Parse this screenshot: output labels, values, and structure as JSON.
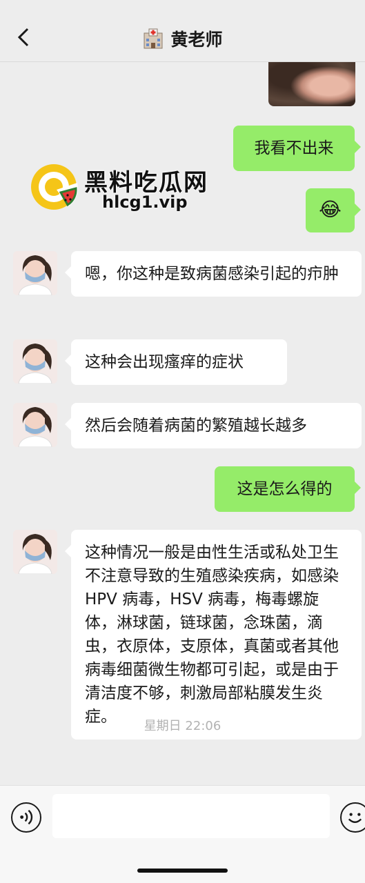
{
  "header": {
    "title": "黄老师",
    "title_icon": "hospital-icon",
    "back_icon": "chevron-left-icon"
  },
  "watermark": {
    "brand": "黑料吃瓜网",
    "url": "hlcg1.vip"
  },
  "messages": [
    {
      "side": "right",
      "type": "text",
      "text": "我看不出来"
    },
    {
      "side": "right",
      "type": "emoji",
      "text": "😂"
    },
    {
      "side": "left",
      "type": "text",
      "text": "嗯，你这种是致病菌感染引起的疖肿"
    },
    {
      "side": "left",
      "type": "text",
      "text": "这种会出现瘙痒的症状"
    },
    {
      "side": "left",
      "type": "text",
      "text": "然后会随着病菌的繁殖越长越多"
    },
    {
      "side": "right",
      "type": "text",
      "text": "这是怎么得的"
    },
    {
      "side": "left",
      "type": "text",
      "text": "这种情况一般是由性生活或私处卫生不注意导致的生殖感染疾病，如感染 HPV 病毒，HSV 病毒，梅毒螺旋体，淋球菌，链球菌，念珠菌，滴虫，衣原体，支原体，真菌或者其他病毒细菌微生物都可引起，或是由于清洁度不够，刺激局部粘膜发生炎症。"
    }
  ],
  "timestamp": "星期日 22:06",
  "inputbar": {
    "voice_icon": "voice-icon",
    "emoji_icon": "emoji-icon",
    "input_value": ""
  },
  "colors": {
    "background": "#ededed",
    "bubble_self": "#95ec69",
    "bubble_other": "#ffffff"
  }
}
